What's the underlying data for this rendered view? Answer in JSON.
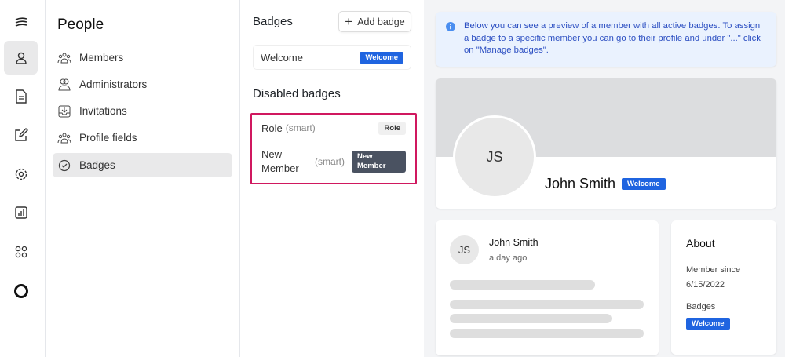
{
  "rail": {
    "items": [
      "menu-icon",
      "person-icon",
      "document-icon",
      "edit-icon",
      "gear-icon",
      "chart-icon",
      "apps-icon",
      "circle-logo-icon"
    ]
  },
  "sidebar": {
    "title": "People",
    "items": [
      {
        "label": "Members"
      },
      {
        "label": "Administrators"
      },
      {
        "label": "Invitations"
      },
      {
        "label": "Profile fields"
      },
      {
        "label": "Badges"
      }
    ]
  },
  "badges": {
    "title": "Badges",
    "add_label": "Add badge",
    "active": [
      {
        "name": "Welcome",
        "pill": "Welcome"
      }
    ],
    "disabled_title": "Disabled badges",
    "disabled": [
      {
        "name": "Role",
        "tag": "(smart)",
        "pill": "Role"
      },
      {
        "name": "New Member",
        "tag": "(smart)",
        "pill": "New Member"
      }
    ]
  },
  "preview": {
    "info": "Below you can see a preview of a member with all active badges. To assign a badge to a specific member you can go to their profile and under \"...\" click on \"Manage badges\".",
    "initials": "JS",
    "name": "John Smith",
    "badge": "Welcome",
    "post": {
      "initials": "JS",
      "author": "John Smith",
      "time": "a day ago"
    },
    "about": {
      "title": "About",
      "member_since_label": "Member since",
      "member_since": "6/15/2022",
      "badges_label": "Badges",
      "badge": "Welcome"
    }
  },
  "colors": {
    "accent": "#1f64e0",
    "highlight": "#d0185f",
    "dark_pill": "#4a5261"
  }
}
